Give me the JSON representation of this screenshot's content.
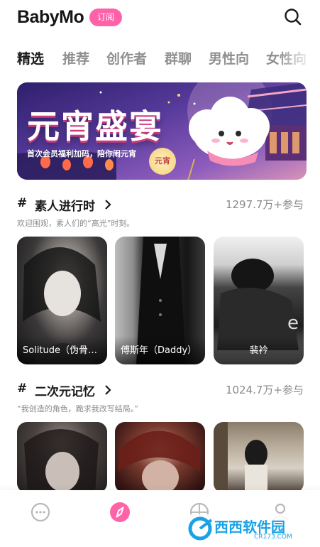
{
  "header": {
    "logo": "BabyMo",
    "subscribe_label": "订阅"
  },
  "tabs": [
    {
      "label": "精选",
      "active": true
    },
    {
      "label": "推荐",
      "active": false
    },
    {
      "label": "创作者",
      "active": false
    },
    {
      "label": "群聊",
      "active": false
    },
    {
      "label": "男性向",
      "active": false
    },
    {
      "label": "女性向",
      "active": false
    }
  ],
  "banner": {
    "title": "元宵盛宴",
    "subtitle": "首次会员福利加码，陪你闹元宵",
    "lantern_text": "元宵"
  },
  "sections": [
    {
      "hash": "#",
      "title": "素人进行时",
      "count": "1297.7万+参与",
      "desc": "欢迎围观，素人们的“高光”时刻。",
      "cards": [
        {
          "name": "Solitude（伪骨…"
        },
        {
          "name": "傅斯年（Daddy）"
        },
        {
          "name": "裴衿"
        }
      ]
    },
    {
      "hash": "#",
      "title": "二次元记忆",
      "count": "1024.7万+参与",
      "desc": "“我创造的角色，跪求我改写结局。”",
      "cards": [
        {
          "name": ""
        },
        {
          "name": ""
        },
        {
          "name": ""
        }
      ]
    }
  ],
  "bottom_nav": [
    {
      "icon": "chat-bubble-icon",
      "active": false
    },
    {
      "icon": "compass-icon",
      "active": true
    },
    {
      "icon": "basketball-icon",
      "active": false
    },
    {
      "icon": "person-icon",
      "active": false
    }
  ],
  "watermark": {
    "text": "西西软件园",
    "sub": "CR173.COM"
  },
  "colors": {
    "accent": "#ff62a8",
    "text_muted": "#8a8a8a"
  }
}
